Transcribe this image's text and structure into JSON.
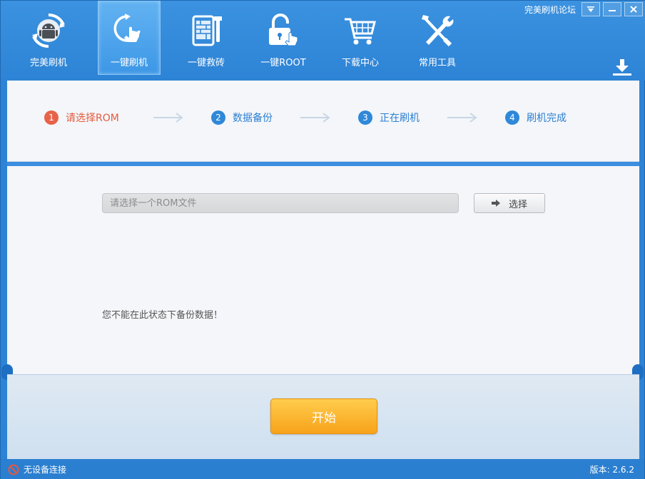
{
  "window": {
    "forum_link": "完美刷机论坛",
    "controls": [
      "dropdown-icon",
      "minimize-icon",
      "close-icon"
    ]
  },
  "tabs": [
    {
      "label": "完美刷机",
      "icon": "android-refresh-icon",
      "active": false
    },
    {
      "label": "一键刷机",
      "icon": "refresh-touch-icon",
      "active": true
    },
    {
      "label": "一键救砖",
      "icon": "brick-repair-icon",
      "active": false
    },
    {
      "label": "一键ROOT",
      "icon": "unlock-icon",
      "active": false
    },
    {
      "label": "下载中心",
      "icon": "cart-icon",
      "active": false
    },
    {
      "label": "常用工具",
      "icon": "tools-icon",
      "active": false
    }
  ],
  "steps": [
    {
      "num": "1",
      "label": "请选择ROM",
      "active": true
    },
    {
      "num": "2",
      "label": "数据备份",
      "active": false
    },
    {
      "num": "3",
      "label": "正在刷机",
      "active": false
    },
    {
      "num": "4",
      "label": "刷机完成",
      "active": false
    }
  ],
  "rom": {
    "placeholder": "请选择一个ROM文件",
    "choose_label": "选择"
  },
  "notice": "您不能在此状态下备份数据！",
  "start_label": "开始",
  "status": {
    "device": "无设备连接",
    "version": "版本: 2.6.2"
  },
  "colors": {
    "primary": "#2d84d6",
    "active_step": "#e55a3e",
    "start_button": "#f7a21a"
  }
}
